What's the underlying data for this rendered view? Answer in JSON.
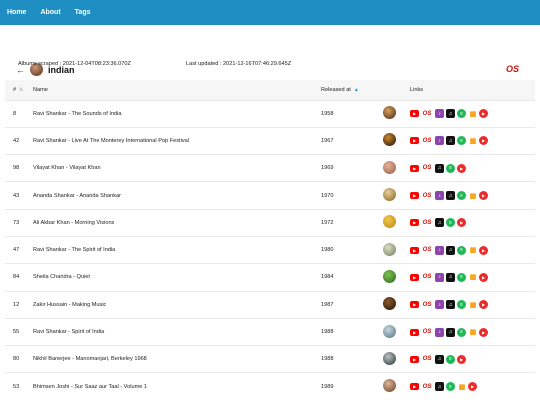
{
  "nav": [
    "Home",
    "About",
    "Tags"
  ],
  "tag": {
    "name": "indian",
    "back_icon": "←",
    "source_icon": "lastfm-icon",
    "source_label": "OS"
  },
  "meta": {
    "scraped_label": "Albums scraped :",
    "scraped_value": "2021-12-04T08:23:36.070Z",
    "updated_label": "Last updated :",
    "updated_value": "2021-12-16T07:46:29.645Z"
  },
  "table": {
    "headers": {
      "num": "#",
      "name": "Name",
      "released": "Released at",
      "links": "Links"
    },
    "colors": {
      "youtube": "#ff0000",
      "lastfm": "#d51007",
      "itunes": "#8e44ad",
      "apple": "#111111",
      "spotify": "#1db954",
      "deezer": "#f5a623",
      "play": "#ee2b2b"
    },
    "rows": [
      {
        "id": "8",
        "name": "Ravi Shankar - The Sounds of India",
        "year": "1958",
        "cover": [
          "#d2a15a",
          "#6b4425"
        ],
        "links": [
          "youtube",
          "lastfm",
          "itunes",
          "apple",
          "spotify",
          "deezer",
          "play"
        ]
      },
      {
        "id": "42",
        "name": "Ravi Shankar - Live At The Monterey International Pop Festival",
        "year": "1967",
        "cover": [
          "#c98a2f",
          "#4a2b12"
        ],
        "links": [
          "youtube",
          "lastfm",
          "itunes",
          "apple",
          "spotify",
          "deezer",
          "play"
        ]
      },
      {
        "id": "98",
        "name": "Vilayat Khan - Vilayat Khan",
        "year": "1969",
        "cover": [
          "#e6b59c",
          "#a8705a"
        ],
        "links": [
          "youtube",
          "lastfm",
          "apple",
          "spotify",
          "play"
        ]
      },
      {
        "id": "43",
        "name": "Ananda Shankar - Ananda Shankar",
        "year": "1970",
        "cover": [
          "#e7d09a",
          "#9c7d3c"
        ],
        "links": [
          "youtube",
          "lastfm",
          "itunes",
          "apple",
          "spotify",
          "deezer",
          "play"
        ]
      },
      {
        "id": "73",
        "name": "Ali Akbar Khan - Morning Visions",
        "year": "1972",
        "cover": [
          "#f2c84a",
          "#c8962a"
        ],
        "links": [
          "youtube",
          "lastfm",
          "apple",
          "spotify",
          "play"
        ]
      },
      {
        "id": "47",
        "name": "Ravi Shankar - The Spirit of India",
        "year": "1980",
        "cover": [
          "#d9dfc4",
          "#8a9472"
        ],
        "links": [
          "youtube",
          "lastfm",
          "itunes",
          "apple",
          "spotify",
          "deezer",
          "play"
        ]
      },
      {
        "id": "84",
        "name": "Sheila Chandra - Quiet",
        "year": "1984",
        "cover": [
          "#7ec24d",
          "#3f7d2a"
        ],
        "links": [
          "youtube",
          "lastfm",
          "itunes",
          "apple",
          "spotify",
          "deezer",
          "play"
        ]
      },
      {
        "id": "12",
        "name": "Zakir Hussain - Making Music",
        "year": "1987",
        "cover": [
          "#8b5a2b",
          "#3a2410"
        ],
        "links": [
          "youtube",
          "lastfm",
          "itunes",
          "apple",
          "spotify",
          "deezer",
          "play"
        ]
      },
      {
        "id": "55",
        "name": "Ravi Shankar - Spirit of India",
        "year": "1988",
        "cover": [
          "#c9d8de",
          "#6d8a96"
        ],
        "links": [
          "youtube",
          "lastfm",
          "itunes",
          "apple",
          "spotify",
          "deezer",
          "play"
        ]
      },
      {
        "id": "80",
        "name": "Nikhil Banerjee - Manomanjari, Berkeley 1968",
        "year": "1988",
        "cover": [
          "#bcc2c4",
          "#4e5658"
        ],
        "links": [
          "youtube",
          "lastfm",
          "apple",
          "spotify",
          "play"
        ]
      },
      {
        "id": "53",
        "name": "Bhimsen Joshi - Sur Saaz aur Taal - Volume 1",
        "year": "1989",
        "cover": [
          "#d9b8a0",
          "#8a5a3a"
        ],
        "links": [
          "youtube",
          "lastfm",
          "apple",
          "spotify",
          "deezer",
          "play"
        ]
      }
    ]
  }
}
